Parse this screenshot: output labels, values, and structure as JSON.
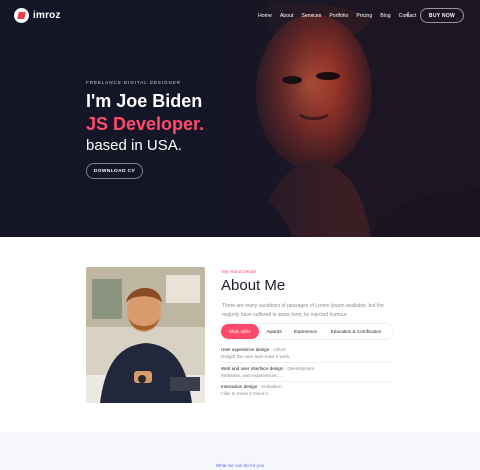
{
  "brand": {
    "name": "imroz"
  },
  "nav": {
    "items": [
      "Home",
      "About",
      "Services",
      "Portfolio",
      "Pricing",
      "Blog",
      "Contact"
    ],
    "cta": "BUY NOW"
  },
  "hero": {
    "tagline": "FREELANCE DIGITAL DESIGNER",
    "title_line1": "I'm Joe Biden",
    "title_line2": "JS Developer.",
    "title_line3": "based in USA.",
    "button": "DOWNLOAD CV"
  },
  "about": {
    "eyebrow": "My About Details",
    "title": "About Me",
    "description": "There are many variations of passages of Lorem Ipsum available, but the majority have suffered in some form, by injected humour.",
    "tabs": [
      "Main skills",
      "Awards",
      "Experience",
      "Education & Certification"
    ],
    "skills": [
      {
        "name": "User experience design",
        "meta": " - UI/UX",
        "sub": "Delight the user and make it work."
      },
      {
        "name": "Web and user interface design",
        "meta": " - Development",
        "sub": "Websites, web experiences, ..."
      },
      {
        "name": "Interaction design",
        "meta": " - Animation",
        "sub": "I like to move it move it."
      }
    ]
  },
  "services": {
    "eyebrow": "What we can do for you"
  },
  "colors": {
    "accent": "#ff4a6b",
    "hero_bg": "#141627",
    "link_blue": "#5b6cf6"
  }
}
